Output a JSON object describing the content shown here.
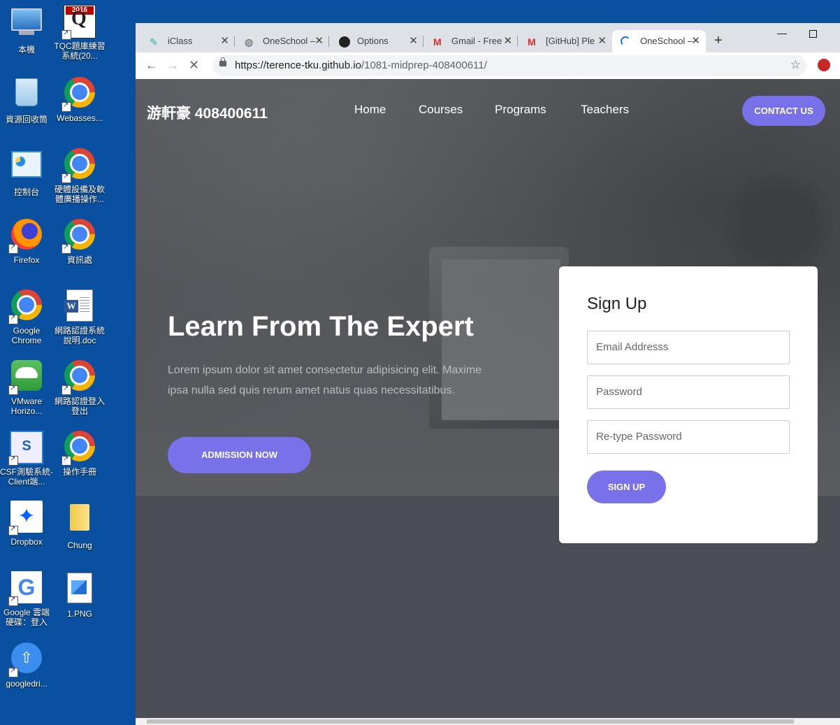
{
  "desktop": {
    "icons": [
      {
        "label": "本機"
      },
      {
        "label": "TQC題庫練習系統(20...",
        "badge": "2016"
      },
      {
        "label": "資源回收筒"
      },
      {
        "label": "Webasses..."
      },
      {
        "label": "控制台"
      },
      {
        "label": "硬體設備及軟體廣播操作..."
      },
      {
        "label": "Firefox"
      },
      {
        "label": "資訊處"
      },
      {
        "label": "Google Chrome"
      },
      {
        "label": "網路認證系統說明.doc"
      },
      {
        "label": "VMware Horizo..."
      },
      {
        "label": "網路認證登入登出"
      },
      {
        "label": "CSF測驗系統-Client端..."
      },
      {
        "label": "操作手冊"
      },
      {
        "label": "Dropbox"
      },
      {
        "label": "Chung"
      },
      {
        "label": "Google 雲端硬碟：登入"
      },
      {
        "label": "1.PNG"
      },
      {
        "label": "googledri..."
      }
    ]
  },
  "browser": {
    "tabs": [
      {
        "title": "iClass",
        "icon": "iclass-icon",
        "active": false
      },
      {
        "title": "OneSchool – ",
        "icon": "globe-icon",
        "active": false
      },
      {
        "title": "Options",
        "icon": "github-icon",
        "active": false
      },
      {
        "title": "Gmail - Free",
        "icon": "gmail-icon",
        "active": false
      },
      {
        "title": "[GitHub] Ple",
        "icon": "gmail-icon",
        "active": false
      },
      {
        "title": "OneSchool – ",
        "icon": "loading-icon",
        "active": true
      }
    ],
    "new_tab": "+",
    "url_host": "https://terence-tku.github.io",
    "url_path": "/1081-midprep-408400611/"
  },
  "site": {
    "brand": "游軒豪 408400611",
    "nav": [
      "Home",
      "Courses",
      "Programs",
      "Teachers"
    ],
    "contact_label": "CONTACT US",
    "headline": "Learn From The Expert",
    "lead": "Lorem ipsum dolor sit amet consectetur adipisicing elit. Maxime ipsa nulla sed quis rerum amet natus quas necessitatibus.",
    "admission_label": "ADMISSION NOW",
    "signup": {
      "title": "Sign Up",
      "email_placeholder": "Email Addresss",
      "password_placeholder": "Password",
      "retype_placeholder": "Re-type Password",
      "submit_label": "SIGN UP"
    },
    "accent_color": "#7971ea"
  }
}
